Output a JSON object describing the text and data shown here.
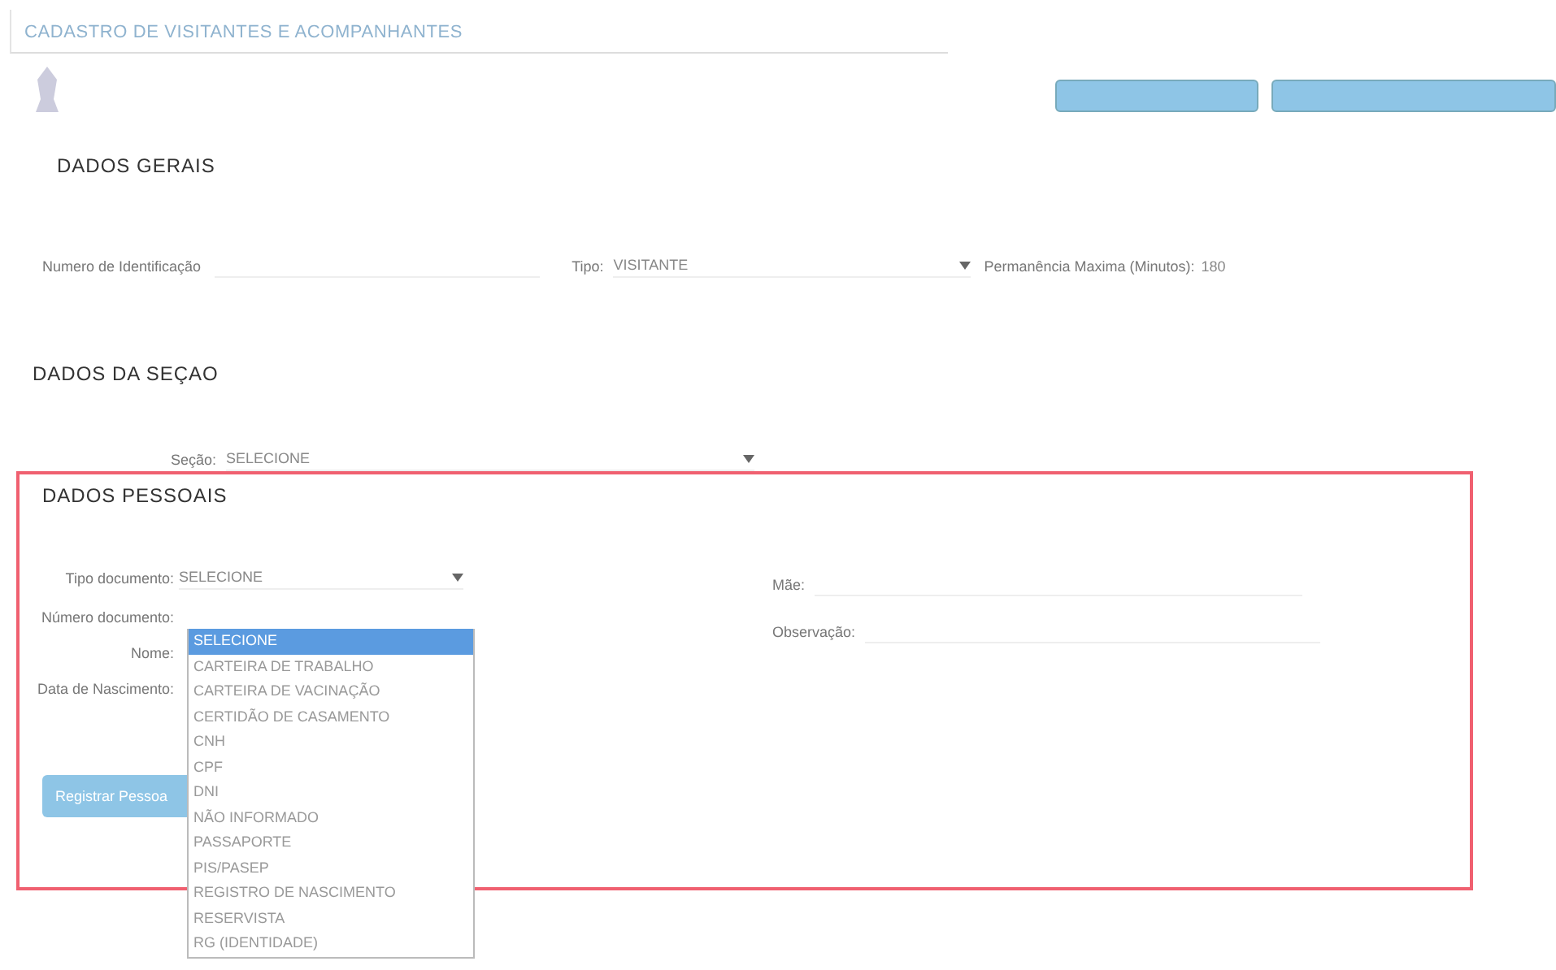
{
  "title": "CADASTRO DE VISITANTES E ACOMPANHANTES",
  "header_buttons": [
    {
      "kind": "button"
    },
    {
      "kind": "button"
    }
  ],
  "dados_gerais": {
    "heading": "DADOS GERAIS",
    "id_label": "Numero de Identificação",
    "tipo_label": "Tipo:",
    "tipo_value": "VISITANTE",
    "perm_label": "Permanência Maxima (Minutos):",
    "perm_value": "180"
  },
  "dados_secao": {
    "heading": "DADOS DA SEÇAO",
    "secao_label": "Seção:",
    "secao_value": "SELECIONE"
  },
  "dados_pessoais": {
    "heading": "DADOS PESSOAIS",
    "highlighted": true,
    "tipo_doc_label": "Tipo documento:",
    "tipo_doc_value": "SELECIONE",
    "numero_doc_label": "Número documento:",
    "nome_label": "Nome:",
    "nascimento_label": "Data de Nascimento:",
    "mae_label": "Mãe:",
    "obs_label": "Observação:",
    "register_button": "Registrar Pessoa",
    "options": [
      {
        "label": "SELECIONE",
        "selected": true
      },
      {
        "label": "CARTEIRA DE TRABALHO",
        "selected": false
      },
      {
        "label": "CARTEIRA DE VACINAÇÃO",
        "selected": false
      },
      {
        "label": "CERTIDÃO DE CASAMENTO",
        "selected": false
      },
      {
        "label": "CNH",
        "selected": false
      },
      {
        "label": "CPF",
        "selected": false
      },
      {
        "label": "DNI",
        "selected": false
      },
      {
        "label": "NÃO INFORMADO",
        "selected": false
      },
      {
        "label": "PASSAPORTE",
        "selected": false
      },
      {
        "label": "PIS/PASEP",
        "selected": false
      },
      {
        "label": "REGISTRO DE NASCIMENTO",
        "selected": false
      },
      {
        "label": "RESERVISTA",
        "selected": false
      },
      {
        "label": "RG (IDENTIDADE)",
        "selected": false
      }
    ]
  }
}
